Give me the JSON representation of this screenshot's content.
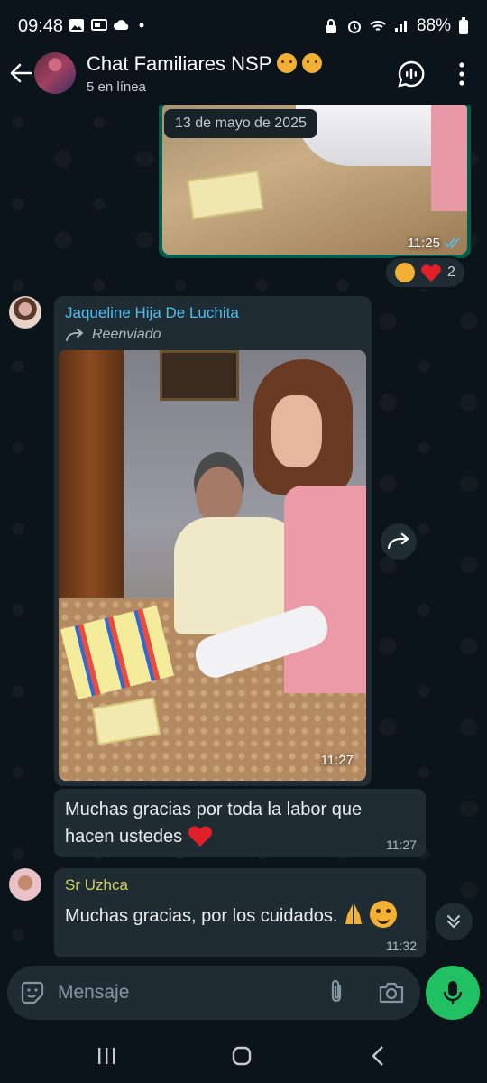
{
  "status_bar": {
    "time": "09:48",
    "battery": "88%"
  },
  "header": {
    "title": "Chat Familiares NSP",
    "subtitle": "5 en línea"
  },
  "date_chip": "13 de mayo de 2025",
  "messages": {
    "outgoing_image": {
      "time": "11:25",
      "reaction_count": "2"
    },
    "forwarded_image": {
      "sender": "Jaqueline Hija De Luchita",
      "sender_color": "#53bdeb",
      "forwarded_label": "Reenviado",
      "time": "11:27"
    },
    "text_1": {
      "line1": "Muchas gracias por toda la labor que",
      "line2": "hacen ustedes",
      "time": "11:27"
    },
    "text_2": {
      "sender": "Sr Uzhca",
      "sender_color": "#d2d55a",
      "text": "Muchas gracias, por los cuidados.",
      "time": "11:32"
    }
  },
  "input": {
    "placeholder": "Mensaje"
  },
  "colors": {
    "background": "#0b141a",
    "incoming_bubble": "#202c33",
    "outgoing_bubble": "#005c4b",
    "accent_green": "#21c063",
    "read_check": "#53bdeb"
  }
}
